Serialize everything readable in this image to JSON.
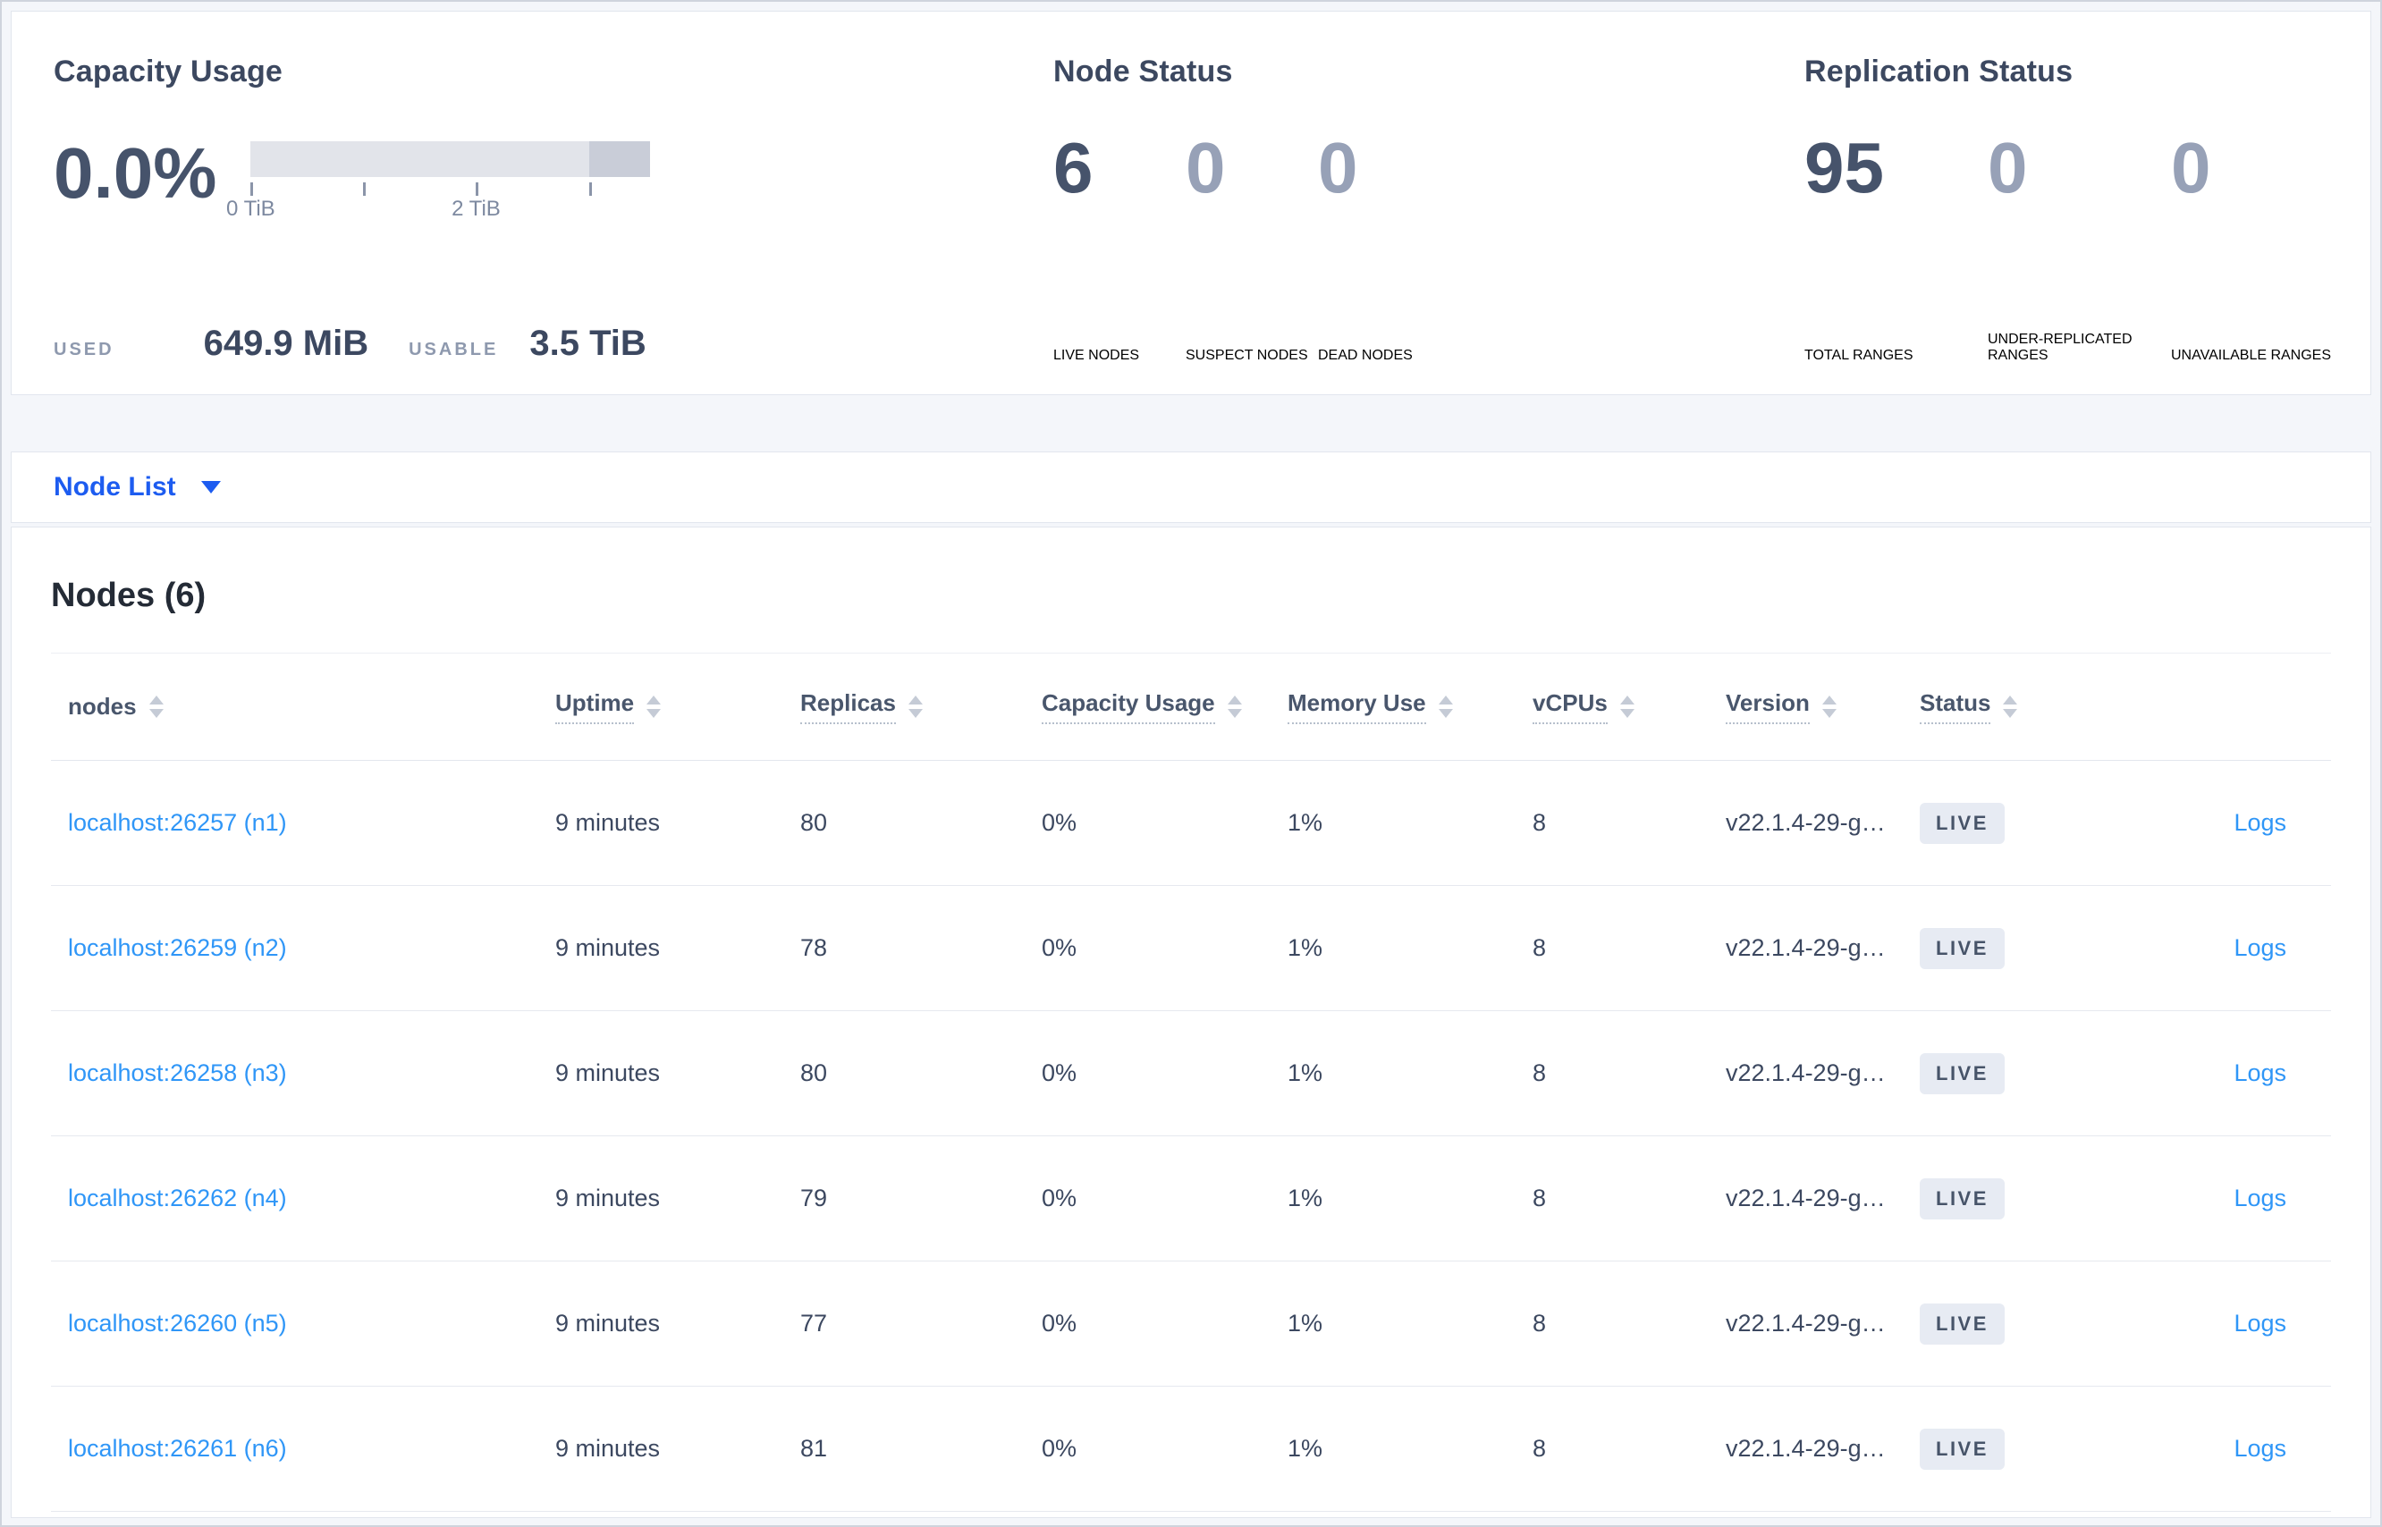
{
  "colors": {
    "page_bg": "#f4f6fa",
    "card_bg": "#ffffff",
    "card_border": "#e2e6ee",
    "text_dark": "#3c4860",
    "text_heading": "#242b36",
    "num_dark": "#46536b",
    "num_light": "#97a1b7",
    "caps_gray": "#8e99ae",
    "accent_blue": "#1d5cf0",
    "link_blue": "#2f96f7",
    "bar_light": "#e2e4ea",
    "bar_dark": "#c9cdd8",
    "divider": "#e6e9ef",
    "badge_bg": "#e7ebf3"
  },
  "capacity_usage": {
    "title": "Capacity Usage",
    "percent": "0.0%",
    "tick_label_start": "0 TiB",
    "tick_label_mid": "2 TiB",
    "used_label": "USED",
    "used_value": "649.9 MiB",
    "usable_label": "USABLE",
    "usable_value": "3.5 TiB"
  },
  "node_status": {
    "title": "Node Status",
    "live": {
      "value": "6",
      "label": "LIVE NODES"
    },
    "suspect": {
      "value": "0",
      "label": "SUSPECT NODES"
    },
    "dead": {
      "value": "0",
      "label": "DEAD NODES"
    }
  },
  "replication_status": {
    "title": "Replication Status",
    "total": {
      "value": "95",
      "label": "TOTAL RANGES"
    },
    "under": {
      "value": "0",
      "label": "UNDER-REPLICATED RANGES"
    },
    "unavailable": {
      "value": "0",
      "label": "UNAVAILABLE RANGES"
    }
  },
  "view_selector": {
    "label": "Node List"
  },
  "table": {
    "title": "Nodes (6)",
    "columns": {
      "nodes": "nodes",
      "uptime": "Uptime",
      "replicas": "Replicas",
      "capacity": "Capacity Usage",
      "memory": "Memory Use",
      "vcpus": "vCPUs",
      "version": "Version",
      "status": "Status"
    },
    "rows": [
      {
        "node": "localhost:26257 (n1)",
        "uptime": "9 minutes",
        "replicas": "80",
        "capacity": "0%",
        "memory": "1%",
        "vcpus": "8",
        "version": "v22.1.4-29-g…",
        "status": "LIVE",
        "logs": "Logs"
      },
      {
        "node": "localhost:26259 (n2)",
        "uptime": "9 minutes",
        "replicas": "78",
        "capacity": "0%",
        "memory": "1%",
        "vcpus": "8",
        "version": "v22.1.4-29-g…",
        "status": "LIVE",
        "logs": "Logs"
      },
      {
        "node": "localhost:26258 (n3)",
        "uptime": "9 minutes",
        "replicas": "80",
        "capacity": "0%",
        "memory": "1%",
        "vcpus": "8",
        "version": "v22.1.4-29-g…",
        "status": "LIVE",
        "logs": "Logs"
      },
      {
        "node": "localhost:26262 (n4)",
        "uptime": "9 minutes",
        "replicas": "79",
        "capacity": "0%",
        "memory": "1%",
        "vcpus": "8",
        "version": "v22.1.4-29-g…",
        "status": "LIVE",
        "logs": "Logs"
      },
      {
        "node": "localhost:26260 (n5)",
        "uptime": "9 minutes",
        "replicas": "77",
        "capacity": "0%",
        "memory": "1%",
        "vcpus": "8",
        "version": "v22.1.4-29-g…",
        "status": "LIVE",
        "logs": "Logs"
      },
      {
        "node": "localhost:26261 (n6)",
        "uptime": "9 minutes",
        "replicas": "81",
        "capacity": "0%",
        "memory": "1%",
        "vcpus": "8",
        "version": "v22.1.4-29-g…",
        "status": "LIVE",
        "logs": "Logs"
      }
    ]
  }
}
